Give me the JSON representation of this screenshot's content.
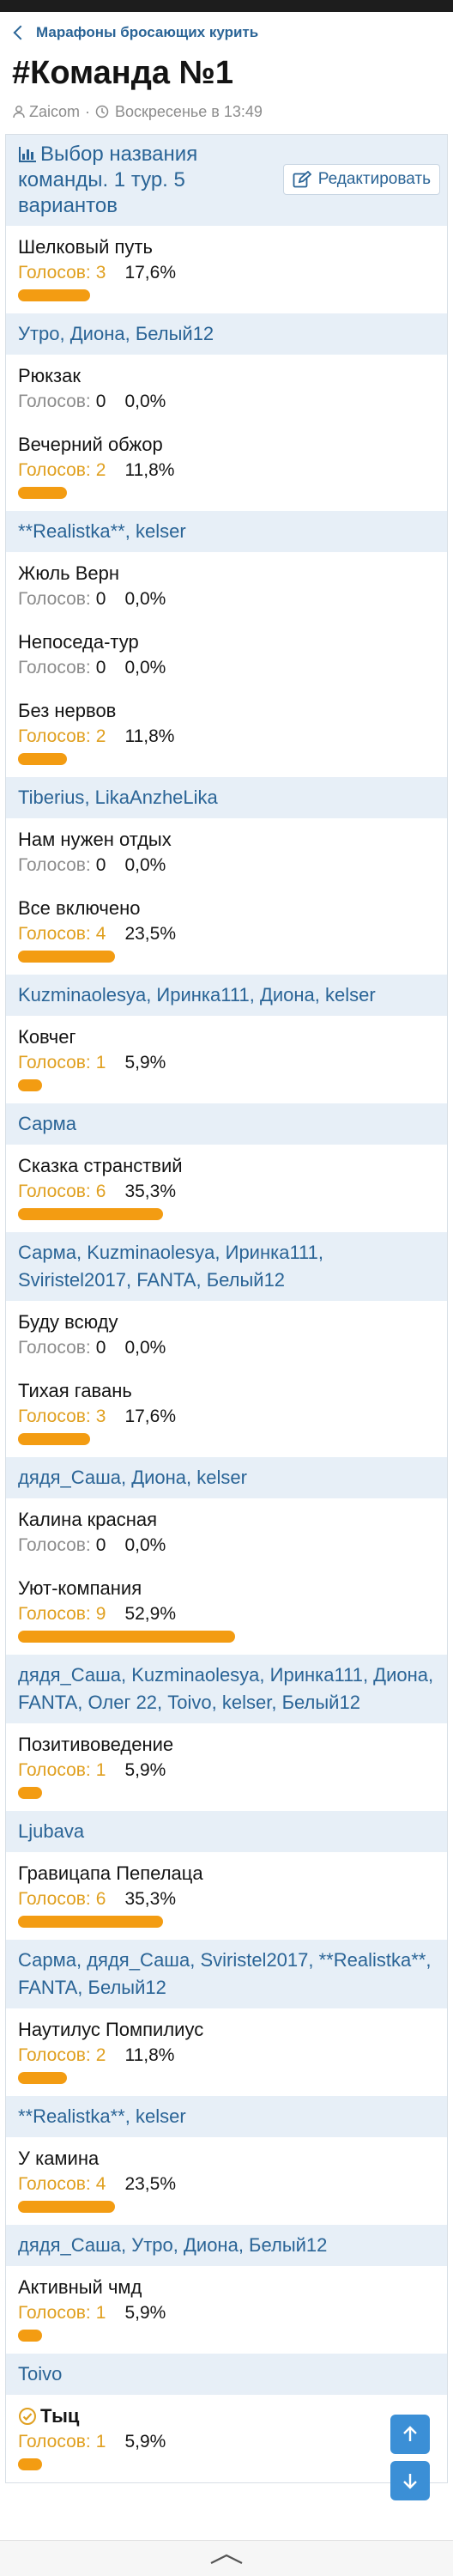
{
  "breadcrumb": {
    "label": "Марафоны бросающих курить"
  },
  "page": {
    "title": "#Команда №1",
    "author": "Zaicom",
    "date": "Воскресенье в 13:49"
  },
  "poll": {
    "title": "Выбор названия команды. 1 тур. 5 вариантов",
    "edit_label": "Редактировать",
    "votes_prefix": "Голосов:",
    "options": [
      {
        "label": "Шелковый путь",
        "votes": "3",
        "pct": "17,6%",
        "fraction": 0.176,
        "voters": [
          "Утро",
          "Диона",
          "Белый12"
        ]
      },
      {
        "label": "Рюкзак",
        "votes": "0",
        "pct": "0,0%",
        "fraction": 0
      },
      {
        "label": "Вечерний обжор",
        "votes": "2",
        "pct": "11,8%",
        "fraction": 0.118,
        "voters": [
          "**Realistka**",
          "kelser"
        ]
      },
      {
        "label": "Жюль Верн",
        "votes": "0",
        "pct": "0,0%",
        "fraction": 0
      },
      {
        "label": "Непоседа-тур",
        "votes": "0",
        "pct": "0,0%",
        "fraction": 0
      },
      {
        "label": "Без нервов",
        "votes": "2",
        "pct": "11,8%",
        "fraction": 0.118,
        "voters": [
          "Tiberius",
          "LikaAnzheLika"
        ]
      },
      {
        "label": "Нам нужен отдых",
        "votes": "0",
        "pct": "0,0%",
        "fraction": 0
      },
      {
        "label": "Все включено",
        "votes": "4",
        "pct": "23,5%",
        "fraction": 0.235,
        "voters": [
          "Kuzminaolesya",
          "Иринка111",
          "Диона",
          "kelser"
        ]
      },
      {
        "label": "Ковчег",
        "votes": "1",
        "pct": "5,9%",
        "fraction": 0.059,
        "voters": [
          "Сарма"
        ]
      },
      {
        "label": "Сказка странствий",
        "votes": "6",
        "pct": "35,3%",
        "fraction": 0.353,
        "voters": [
          "Сарма",
          "Kuzminaolesya",
          "Иринка111",
          "Sviristel2017",
          "FANTA",
          "Белый12"
        ]
      },
      {
        "label": "Буду всюду",
        "votes": "0",
        "pct": "0,0%",
        "fraction": 0
      },
      {
        "label": "Тихая гавань",
        "votes": "3",
        "pct": "17,6%",
        "fraction": 0.176,
        "voters": [
          "дядя_Саша",
          "Диона",
          "kelser"
        ]
      },
      {
        "label": "Калина красная",
        "votes": "0",
        "pct": "0,0%",
        "fraction": 0
      },
      {
        "label": "Уют-компания",
        "votes": "9",
        "pct": "52,9%",
        "fraction": 0.529,
        "voters": [
          "дядя_Саша",
          "Kuzminaolesya",
          "Иринка111",
          "Диона",
          "FANTA",
          "Олег 22",
          "Toivo",
          "kelser",
          "Белый12"
        ]
      },
      {
        "label": "Позитивоведение",
        "votes": "1",
        "pct": "5,9%",
        "fraction": 0.059,
        "voters": [
          "Ljubava"
        ]
      },
      {
        "label": "Гравицапа Пепелаца",
        "votes": "6",
        "pct": "35,3%",
        "fraction": 0.353,
        "voters": [
          "Сарма",
          "дядя_Саша",
          "Sviristel2017",
          "**Realistka**",
          "FANTA",
          "Белый12"
        ]
      },
      {
        "label": "Наутилус Помпилиус",
        "votes": "2",
        "pct": "11,8%",
        "fraction": 0.118,
        "voters": [
          "**Realistka**",
          "kelser"
        ]
      },
      {
        "label": "У камина",
        "votes": "4",
        "pct": "23,5%",
        "fraction": 0.235,
        "voters": [
          "дядя_Саша",
          "Утро",
          "Диона",
          "Белый12"
        ]
      },
      {
        "label": "Активный чмд",
        "votes": "1",
        "pct": "5,9%",
        "fraction": 0.059,
        "voters": [
          "Toivo"
        ]
      },
      {
        "label": "Тыц",
        "votes": "1",
        "pct": "5,9%",
        "fraction": 0.059,
        "selected": true
      }
    ]
  },
  "colors": {
    "accent": "#2a6496",
    "bar": "#f39c12",
    "voters_bg": "#e7eff7",
    "float_btn": "#3b8fd6"
  },
  "icons": [
    "chevron-left-icon",
    "user-icon",
    "clock-icon",
    "poll-chart-icon",
    "edit-icon",
    "check-circle-icon",
    "arrow-up-icon",
    "arrow-down-icon",
    "chevron-up-icon"
  ]
}
